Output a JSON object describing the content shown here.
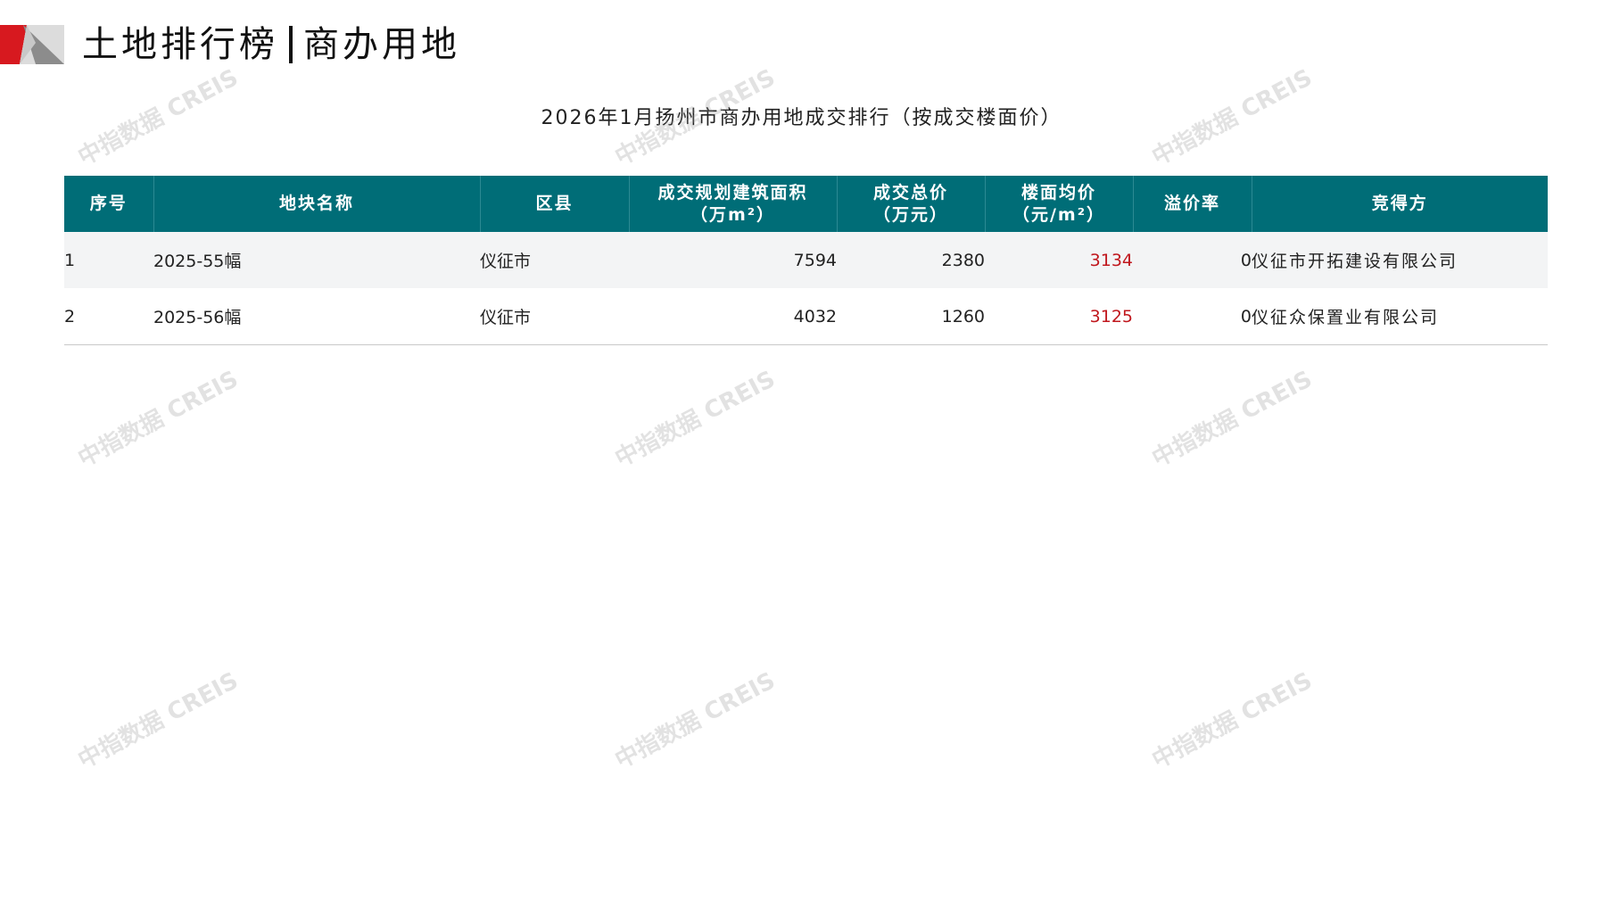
{
  "header": {
    "title_main": "土地排行榜",
    "title_sub": "商办用地"
  },
  "caption": "2026年1月扬州市商办用地成交排行（按成交楼面价）",
  "table": {
    "columns": [
      "序号",
      "地块名称",
      "区县",
      "成交规划建筑面积\n（万m²）",
      "成交总价\n（万元）",
      "楼面均价\n（元/m²）",
      "溢价率",
      "竞得方"
    ],
    "rows": [
      {
        "no": "1",
        "name": "2025-55幅",
        "district": "仪征市",
        "area": "7594",
        "total": "2380",
        "price": "3134",
        "premium": "0",
        "winner": "仪征市开拓建设有限公司"
      },
      {
        "no": "2",
        "name": "2025-56幅",
        "district": "仪征市",
        "area": "4032",
        "total": "1260",
        "price": "3125",
        "premium": "0",
        "winner": "仪征众保置业有限公司"
      }
    ]
  },
  "watermark": "中指数据 CREIS",
  "colors": {
    "header_bg": "#006d77",
    "price_text": "#c0171d",
    "logo_red": "#d7191f",
    "logo_gray": "#9a9a9a"
  }
}
